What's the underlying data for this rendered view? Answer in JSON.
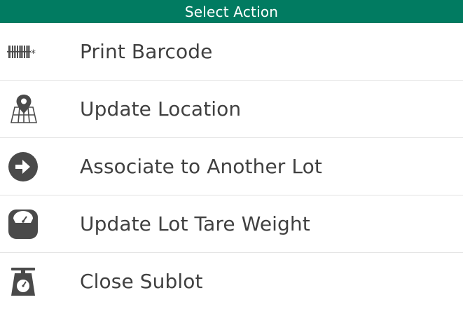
{
  "header": {
    "title": "Select Action",
    "background": "#017b61"
  },
  "actions": [
    {
      "label": "Print Barcode",
      "icon": "barcode-icon"
    },
    {
      "label": "Update Location",
      "icon": "map-pin-icon"
    },
    {
      "label": "Associate to Another Lot",
      "icon": "arrow-right-circle-icon"
    },
    {
      "label": "Update Lot Tare Weight",
      "icon": "scale-dial-icon"
    },
    {
      "label": "Close Sublot",
      "icon": "weighing-scale-icon"
    }
  ]
}
